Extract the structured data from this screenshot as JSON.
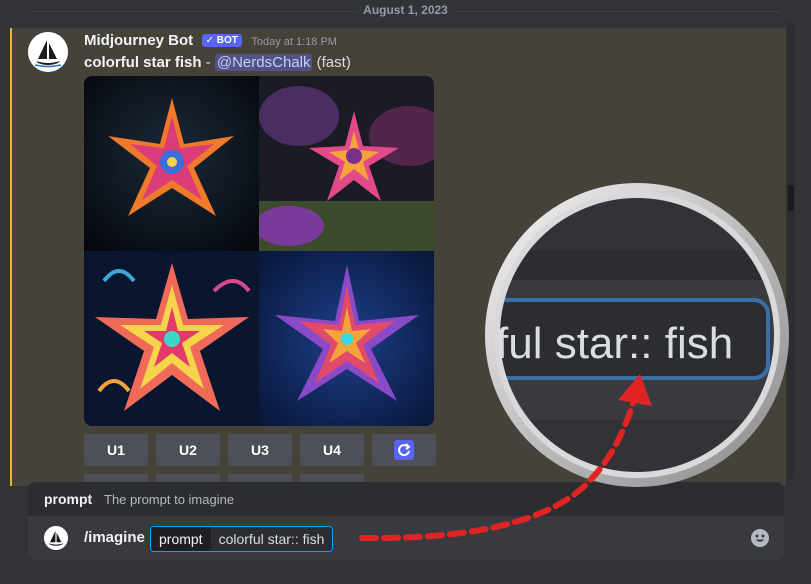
{
  "date_divider": "August 1, 2023",
  "message": {
    "username": "Midjourney Bot",
    "bot_tag": "✓ BOT",
    "timestamp": "Today at 1:18 PM",
    "prompt_text": "colorful star fish",
    "separator": " - ",
    "mention": "@NerdsChalk",
    "speed": "(fast)"
  },
  "upscale_buttons": [
    "U1",
    "U2",
    "U3",
    "U4"
  ],
  "reroll_icon": "refresh-icon",
  "option_hint": {
    "name": "prompt",
    "description": "The prompt to imagine"
  },
  "chat_input": {
    "command": "/imagine",
    "option_key": "prompt",
    "option_value": "colorful star:: fish"
  },
  "zoom": {
    "text": "ful star:: fish"
  },
  "colors": {
    "background": "#313338",
    "highlight": "#45423a",
    "accent_bar": "#f0b232",
    "bot_tag": "#5865f2",
    "button": "#4e5058",
    "reroll_button": "#5865f2",
    "arrow": "#e02424"
  }
}
